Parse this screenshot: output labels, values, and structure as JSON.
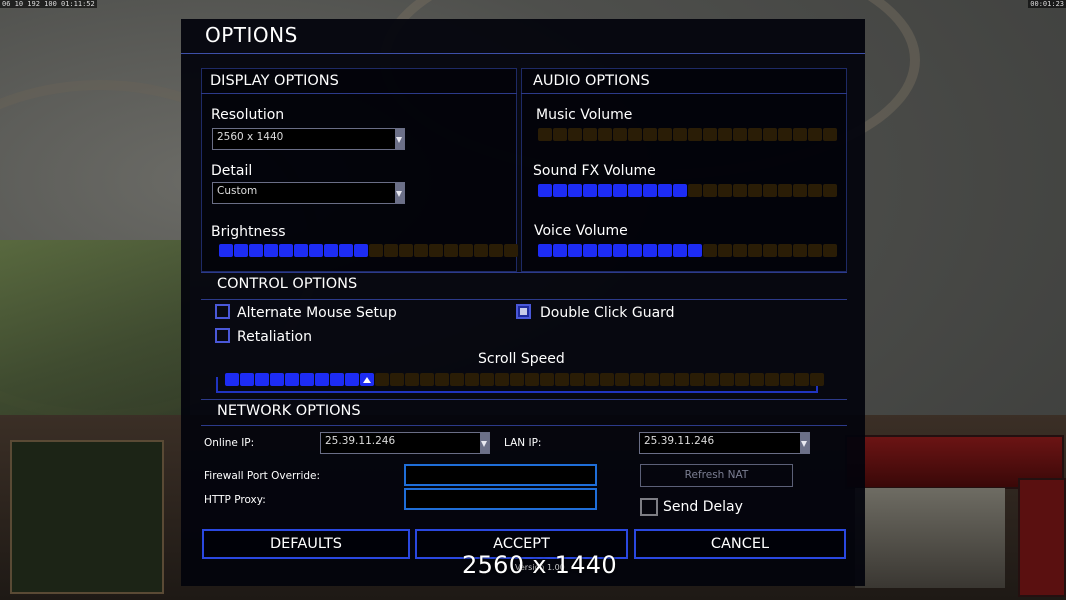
{
  "hud": {
    "top_left_stats": "06 10 192 100 01:11:52",
    "top_right_time": "00:01:23"
  },
  "dialog": {
    "title": "OPTIONS"
  },
  "display": {
    "heading": "DISPLAY OPTIONS",
    "resolution_label": "Resolution",
    "resolution_value": "2560 x 1440",
    "detail_label": "Detail",
    "detail_value": "Custom",
    "brightness_label": "Brightness",
    "brightness_level": 10,
    "brightness_total": 20
  },
  "audio": {
    "heading": "AUDIO OPTIONS",
    "music_label": "Music Volume",
    "music_level": 0,
    "music_total": 20,
    "sfx_label": "Sound FX Volume",
    "sfx_level": 10,
    "sfx_total": 20,
    "voice_label": "Voice Volume",
    "voice_level": 11,
    "voice_total": 20
  },
  "control": {
    "heading": "CONTROL OPTIONS",
    "alt_mouse_label": "Alternate Mouse Setup",
    "alt_mouse_checked": false,
    "double_click_label": "Double Click Guard",
    "double_click_checked": true,
    "retaliation_label": "Retaliation",
    "retaliation_checked": false,
    "scroll_label": "Scroll Speed",
    "scroll_level": 10,
    "scroll_total": 40
  },
  "network": {
    "heading": "NETWORK OPTIONS",
    "online_ip_label": "Online IP:",
    "online_ip_value": "25.39.11.246",
    "lan_ip_label": "LAN IP:",
    "lan_ip_value": "25.39.11.246",
    "firewall_label": "Firewall Port Override:",
    "firewall_value": "",
    "proxy_label": "HTTP Proxy:",
    "proxy_value": "",
    "refresh_nat_label": "Refresh NAT",
    "send_delay_label": "Send Delay",
    "send_delay_checked": false
  },
  "buttons": {
    "defaults": "DEFAULTS",
    "accept": "ACCEPT",
    "cancel": "CANCEL"
  },
  "version_text": "Version 1.00",
  "overlay_text": "2560 x 1440",
  "colors": {
    "accent": "#1d2cf4",
    "slider_off": "#2a1d06",
    "border": "#2c3a8a",
    "field_border": "#1f6ed8"
  }
}
